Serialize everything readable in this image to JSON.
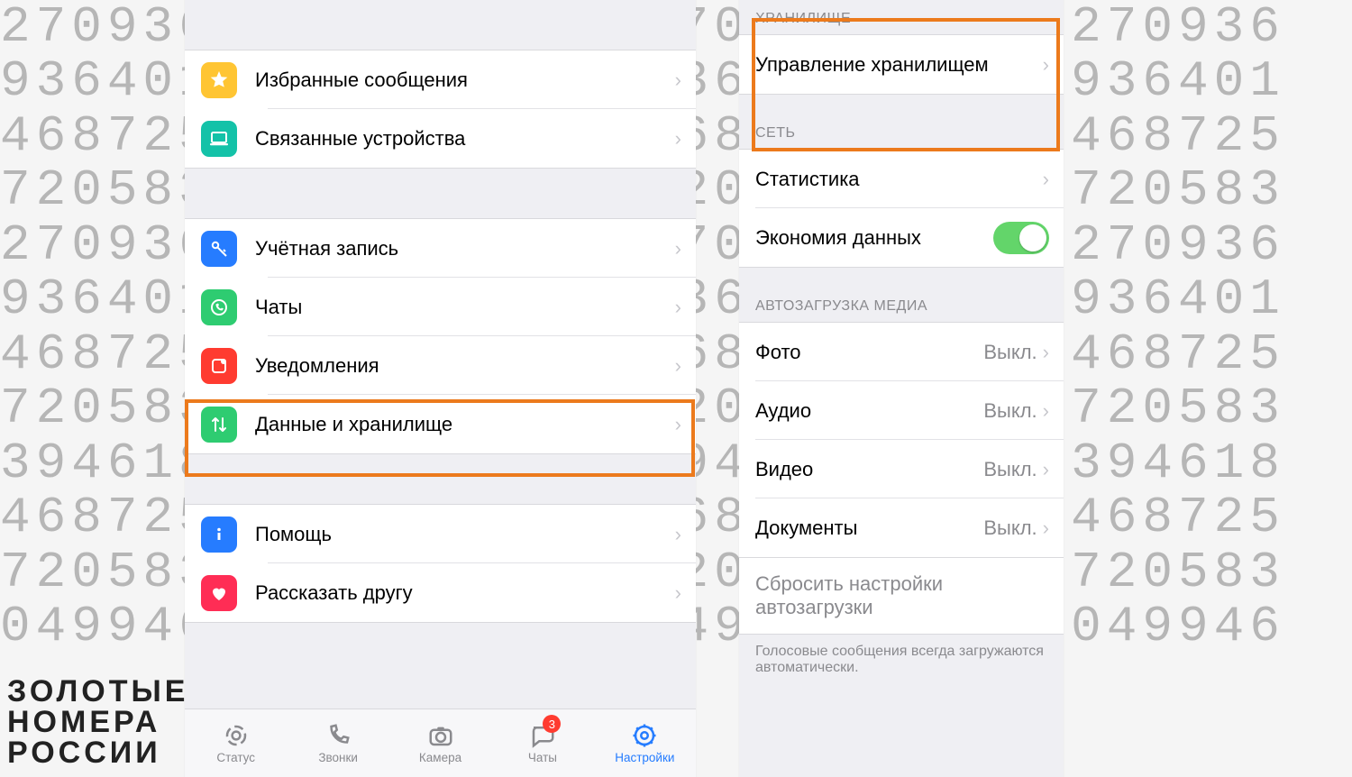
{
  "background_rows": [
    "270936",
    "936401",
    "468725",
    "720583",
    "270936",
    "936401",
    "468725",
    "720583",
    "394618",
    "468725",
    "720583",
    "049946"
  ],
  "logo_lines": [
    "ЗОЛОТЫЕ",
    "НОМЕРА",
    "РОССИИ"
  ],
  "left": {
    "groups": [
      {
        "items": [
          {
            "icon": "star",
            "color": "#ffc533",
            "label": "Избранные сообщения"
          },
          {
            "icon": "laptop",
            "color": "#14c2a8",
            "label": "Связанные устройства"
          }
        ]
      },
      {
        "items": [
          {
            "icon": "key",
            "color": "#267cff",
            "label": "Учётная запись"
          },
          {
            "icon": "whatsapp",
            "color": "#2ecc71",
            "label": "Чаты"
          },
          {
            "icon": "bell",
            "color": "#ff3b30",
            "label": "Уведомления"
          },
          {
            "icon": "updown",
            "color": "#2ecc71",
            "label": "Данные и хранилище",
            "highlight": true
          }
        ]
      },
      {
        "items": [
          {
            "icon": "info",
            "color": "#267cff",
            "label": "Помощь"
          },
          {
            "icon": "heart",
            "color": "#ff2d55",
            "label": "Рассказать другу"
          }
        ]
      }
    ],
    "tabs": [
      {
        "icon": "status",
        "label": "Статус"
      },
      {
        "icon": "calls",
        "label": "Звонки"
      },
      {
        "icon": "camera",
        "label": "Камера"
      },
      {
        "icon": "chats",
        "label": "Чаты",
        "badge": "3"
      },
      {
        "icon": "settings",
        "label": "Настройки",
        "active": true
      }
    ]
  },
  "right": {
    "section_storage": "ХРАНИЛИЩЕ",
    "storage_mgmt": "Управление хранилищем",
    "section_network": "СЕТЬ",
    "network_items": [
      {
        "label": "Статистика",
        "type": "chevron"
      },
      {
        "label": "Экономия данных",
        "type": "toggle",
        "on": true
      }
    ],
    "section_autoload": "АВТОЗАГРУЗКА МЕДИА",
    "autoload_items": [
      {
        "label": "Фото",
        "value": "Выкл."
      },
      {
        "label": "Аудио",
        "value": "Выкл."
      },
      {
        "label": "Видео",
        "value": "Выкл."
      },
      {
        "label": "Документы",
        "value": "Выкл."
      }
    ],
    "reset_label": "Сбросить настройки автозагрузки",
    "footer_note": "Голосовые сообщения всегда загружаются автоматически."
  }
}
